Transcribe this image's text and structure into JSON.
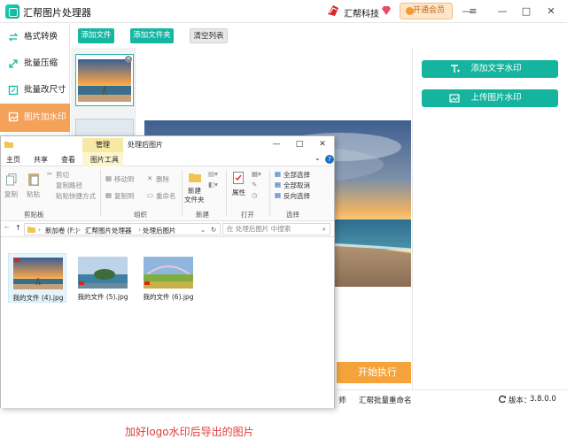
{
  "app": {
    "title": "汇帮图片处理器",
    "brand": "汇帮科技",
    "vip_label": "开通会员"
  },
  "window_controls": [
    "—",
    "≡",
    "—",
    "□",
    "✕"
  ],
  "sidebar": {
    "items": [
      {
        "label": "格式转换",
        "icon": "format-convert-icon",
        "active": false
      },
      {
        "label": "批量压缩",
        "icon": "compress-icon",
        "active": false
      },
      {
        "label": "批量改尺寸",
        "icon": "resize-icon",
        "active": false
      },
      {
        "label": "图片加水印",
        "icon": "watermark-icon",
        "active": true
      }
    ]
  },
  "toolbar": {
    "add_file": "添加文件",
    "add_folder": "添加文件夹",
    "clear_list": "清空列表"
  },
  "right_panel": {
    "add_text_watermark": "添加文字水印",
    "upload_image_watermark": "上传图片水印"
  },
  "start_label": "开始执行",
  "status": {
    "partial": "师",
    "rename": "汇帮批量重命名",
    "version_label": "版本：",
    "version": "3.8.0.0"
  },
  "explorer": {
    "manage_tab": "管理",
    "title": "处理后图片",
    "tabs": [
      "主页",
      "共享",
      "查看",
      "图片工具"
    ],
    "ribbon": {
      "copy": "复制",
      "paste": "粘贴",
      "cut": "剪切",
      "copy_path": "复制路径",
      "paste_shortcut": "粘贴快捷方式",
      "clipboard_group": "剪贴板",
      "move_to": "移动到",
      "copy_to": "复制到",
      "delete": "删除",
      "rename": "重命名",
      "organize_group": "组织",
      "new_folder_1": "新建",
      "new_folder_2": "文件夹",
      "new_group": "新建",
      "properties": "属性",
      "open_group": "打开",
      "select_all": "全部选择",
      "select_none": "全部取消",
      "invert_select": "反向选择",
      "select_group": "选择"
    },
    "breadcrumbs": [
      "新加卷 (F:)",
      "汇帮图片处理器",
      "处理后图片"
    ],
    "search_placeholder": "在 处理后图片 中搜索",
    "files": [
      {
        "name": "我的文件 (4).jpg"
      },
      {
        "name": "我的文件 (5).jpg"
      },
      {
        "name": "我的文件 (6).jpg"
      }
    ],
    "caption": "加好logo水印后导出的图片"
  }
}
